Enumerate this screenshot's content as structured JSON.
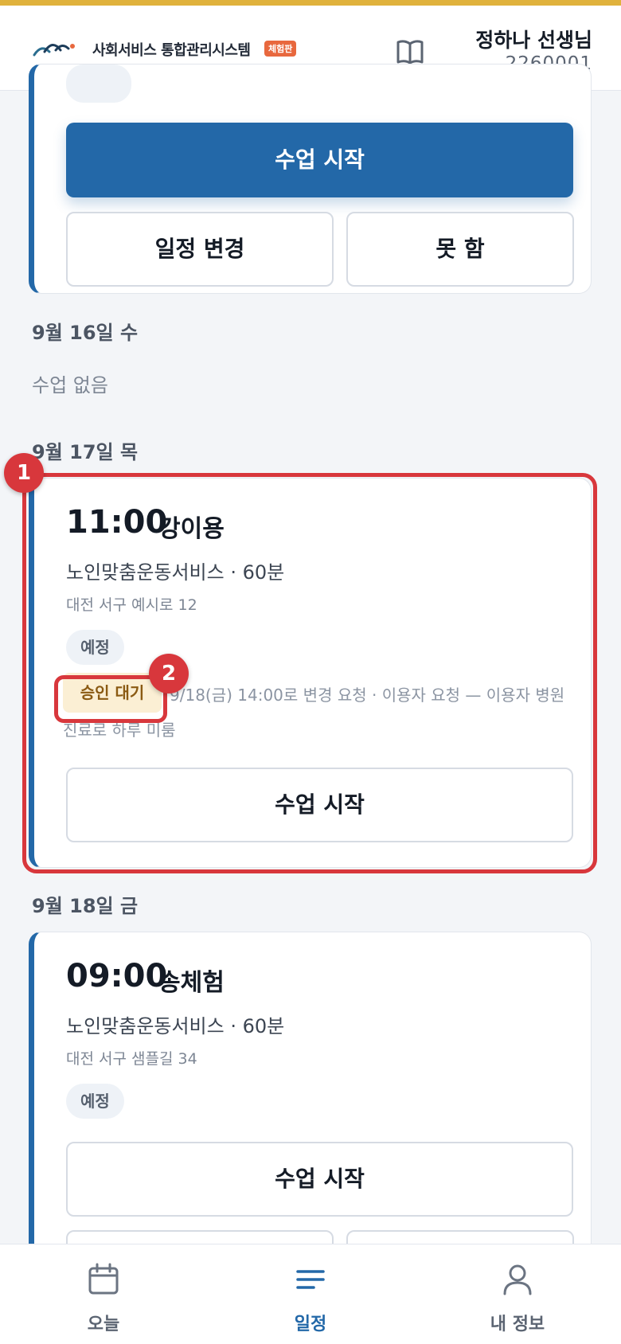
{
  "header": {
    "brand_name": "사회서비스 통합관리시스템",
    "brand_badge": "체험판",
    "user_name": "정하나 선생님",
    "user_id": "2260001"
  },
  "cards": [
    {
      "primary_label": "수업 시작",
      "reschedule_label": "일정 변경",
      "cancel_label": "못 함"
    },
    {
      "date": "9월 17일 목",
      "time": "11:00",
      "client": "강이용",
      "service": "노인맞춤운동서비스 · 60분",
      "address": "대전 서구 예시로 12",
      "status": "예정",
      "approval_badge": "승인 대기",
      "approval_text": "9/18(금) 14:00로 변경 요청 · 이용자 요청 — 이용자 병원 진료로 하루 미룸",
      "start_label": "수업 시작"
    },
    {
      "date": "9월 18일 금",
      "time": "09:00",
      "client": "송체험",
      "service": "노인맞춤운동서비스 · 60분",
      "address": "대전 서구 샘플길 34",
      "status": "예정",
      "start_label": "수업 시작"
    }
  ],
  "empty_day": {
    "date": "9월 16일 수",
    "text": "수업 없음"
  },
  "markers": [
    "1",
    "2"
  ],
  "bottom_nav": [
    {
      "label": "오늘",
      "icon": "calendar-icon",
      "active": false
    },
    {
      "label": "일정",
      "icon": "list-icon",
      "active": true
    },
    {
      "label": "내 정보",
      "icon": "person-icon",
      "active": false
    }
  ],
  "colors": {
    "accent": "#2368a8",
    "highlight": "#d8373c",
    "approval_bg": "#fbefd4",
    "brand_badge": "#e8683e",
    "top_strip": "#e0b23c"
  }
}
